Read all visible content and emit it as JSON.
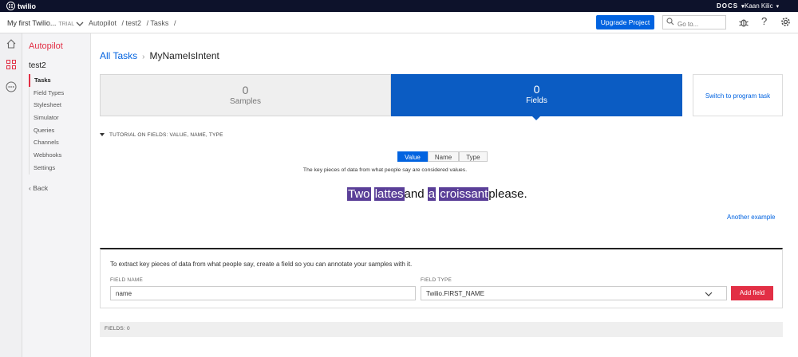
{
  "topbar": {
    "brand": "twilio",
    "docs": "DOCS",
    "user": "Kaan Kilic"
  },
  "subbar": {
    "account": "My first Twilio...",
    "trial": "TRIAL",
    "breadcrumbs": [
      "Autopilot",
      "/ test2",
      "/ Tasks",
      "/"
    ],
    "upgrade_label": "Upgrade Project",
    "search_placeholder": "Go to...",
    "help": "?"
  },
  "sidenav": {
    "title": "Autopilot",
    "project": "test2",
    "items": [
      {
        "label": "Tasks"
      },
      {
        "label": "Field Types"
      },
      {
        "label": "Stylesheet"
      },
      {
        "label": "Simulator"
      },
      {
        "label": "Queries"
      },
      {
        "label": "Channels"
      },
      {
        "label": "Webhooks"
      },
      {
        "label": "Settings"
      }
    ],
    "back": "‹ Back"
  },
  "main": {
    "crumb_link": "All Tasks",
    "crumb_sep": "›",
    "task_name": "MyNameIsIntent",
    "samples": {
      "count": "0",
      "label": "Samples"
    },
    "fields": {
      "count": "0",
      "label": "Fields"
    },
    "switch_label": "Switch to program task",
    "tutorial": "TUTORIAL ON FIELDS: VALUE, NAME, TYPE",
    "segments": [
      "Value",
      "Name",
      "Type"
    ],
    "description": "The key pieces of data from what people say are considered values.",
    "example": {
      "w1": "Two",
      "w2": "lattes",
      "w3": "and",
      "w4": "a",
      "w5": "croissant",
      "w6": "please."
    },
    "another_example": "Another example",
    "card_text": "To extract key pieces of data from what people say, create a field so you can annotate your samples with it.",
    "field_name_label": "FIELD NAME",
    "field_name_value": "name",
    "field_type_label": "FIELD TYPE",
    "field_type_value": "Twilio.FIRST_NAME",
    "add_field": "Add field",
    "fields_count": "FIELDS: 0"
  },
  "colors": {
    "brand_red": "#e22f45",
    "accent_blue": "#0263e0",
    "tile_blue": "#0b5cc3",
    "highlight_purple": "#5a3f98",
    "topbar": "#0d122b"
  }
}
